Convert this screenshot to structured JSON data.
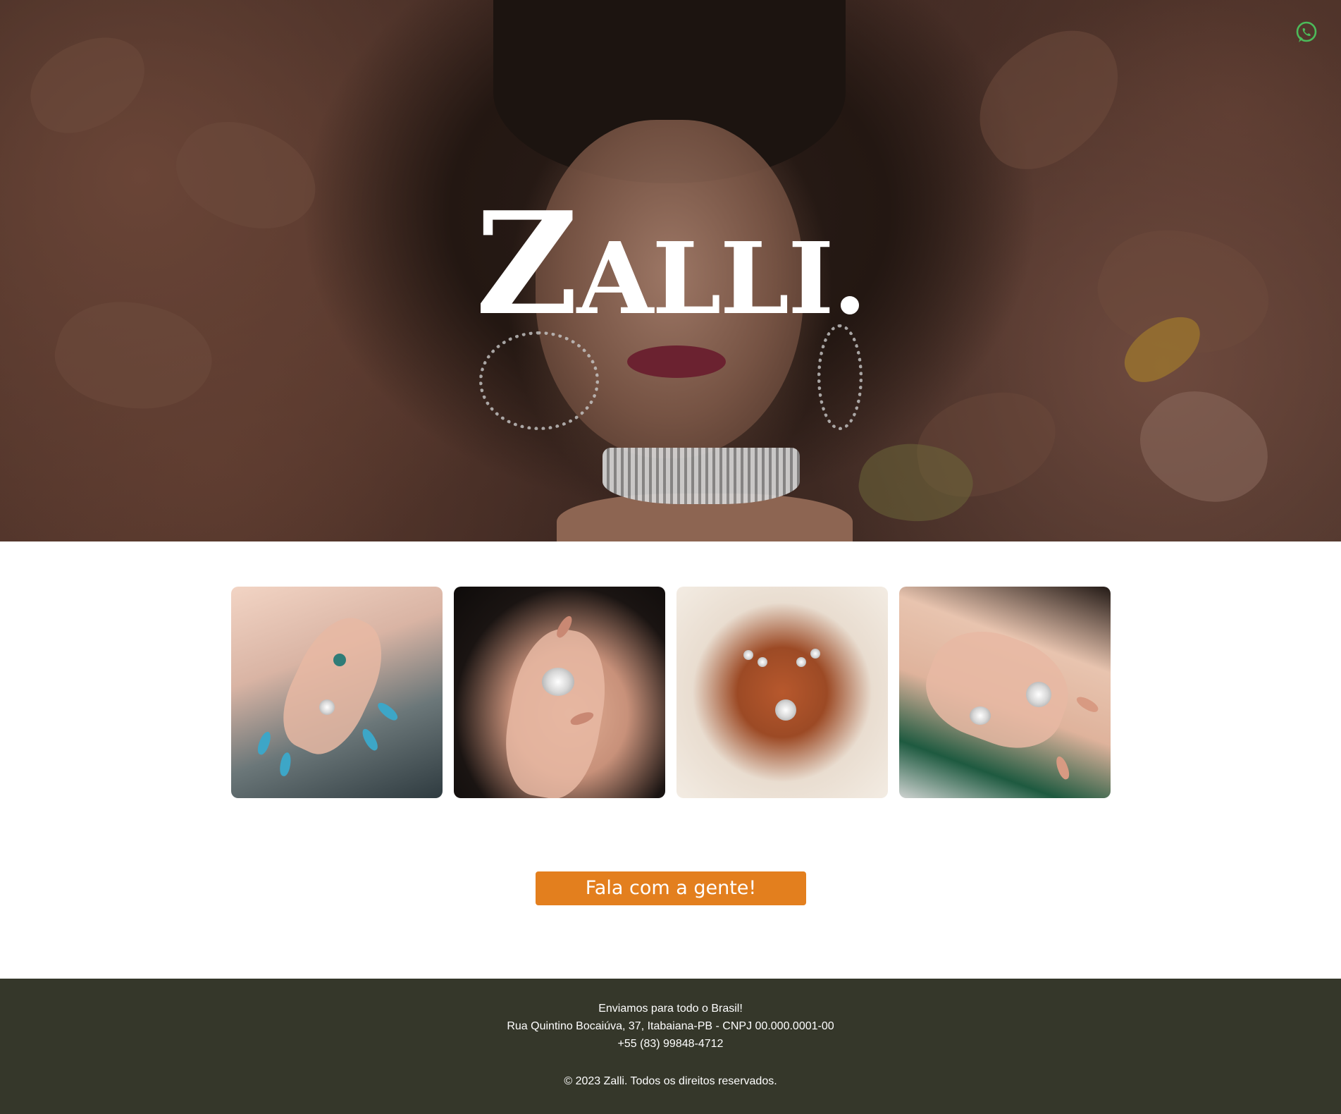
{
  "hero": {
    "brand_initial": "Z",
    "brand_rest": "ALLI.",
    "whatsapp_icon": "whatsapp-icon",
    "whatsapp_color": "#4cbb5a"
  },
  "gallery": {
    "images": [
      {
        "icon": "hands-rings-blue-nails-photo"
      },
      {
        "icon": "hand-flower-ring-photo"
      },
      {
        "icon": "pearl-heart-necklace-photo"
      },
      {
        "icon": "hands-diamond-rings-photo"
      }
    ]
  },
  "cta": {
    "label": "Fala com a gente!",
    "color": "#e37f1e"
  },
  "footer": {
    "shipping": "Enviamos para todo o Brasil!",
    "address": "Rua Quintino Bocaiúva, 37, Itabaiana-PB - CNPJ 00.000.0001-00",
    "phone": "+55 (83) 99848-4712",
    "copyright": "© 2023 Zalli. Todos os direitos reservados.",
    "background": "#35372a"
  }
}
